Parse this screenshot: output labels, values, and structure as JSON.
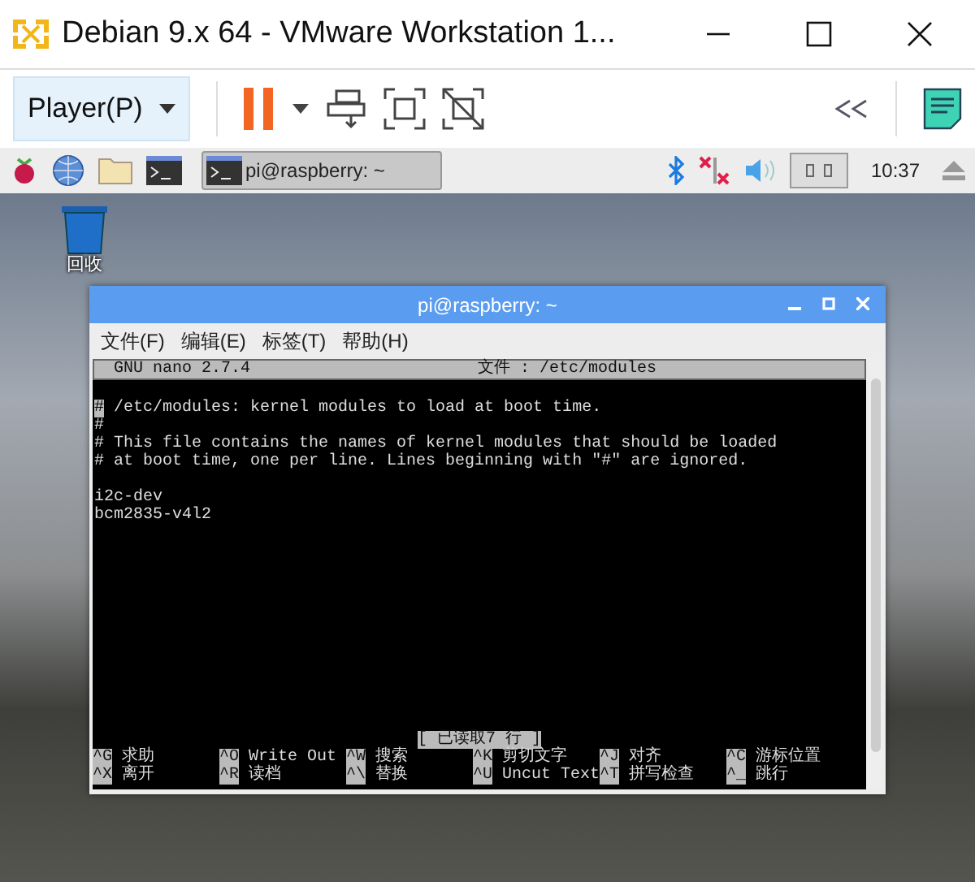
{
  "window": {
    "title": "Debian 9.x 64  - VMware Workstation 1..."
  },
  "toolbar": {
    "player_menu": "Player(P)"
  },
  "taskbar": {
    "task": "pi@raspberry: ~",
    "clock": "10:37"
  },
  "desktop": {
    "icons": [
      {
        "label": "回收"
      }
    ]
  },
  "terminal": {
    "title": "pi@raspberry: ~",
    "menu": [
      "文件(F)",
      "编辑(E)",
      "标签(T)",
      "帮助(H)"
    ],
    "nano": {
      "version": "GNU nano 2.7.4",
      "file": "文件 :  /etc/modules",
      "comment_lines": [
        "# /etc/modules: kernel modules to load at boot time.",
        "#",
        "# This file contains the names of kernel modules that should be loaded",
        "# at boot time, one per line. Lines beginning with \"#\" are ignored."
      ],
      "module_lines": [
        "i2c-dev",
        "bcm2835-v4l2"
      ],
      "status": "[ 已读取7 行 ]",
      "shortcuts": [
        {
          "key": "^G",
          "label": "求助"
        },
        {
          "key": "^O",
          "label": "Write Out"
        },
        {
          "key": "^W",
          "label": "搜索"
        },
        {
          "key": "^K",
          "label": "剪切文字"
        },
        {
          "key": "^J",
          "label": "对齐"
        },
        {
          "key": "^C",
          "label": "游标位置"
        },
        {
          "key": "^X",
          "label": "离开"
        },
        {
          "key": "^R",
          "label": "读档"
        },
        {
          "key": "^\\",
          "label": "替换"
        },
        {
          "key": "^U",
          "label": "Uncut Text"
        },
        {
          "key": "^T",
          "label": "拼写检查"
        },
        {
          "key": "^_",
          "label": "跳行"
        }
      ]
    }
  }
}
